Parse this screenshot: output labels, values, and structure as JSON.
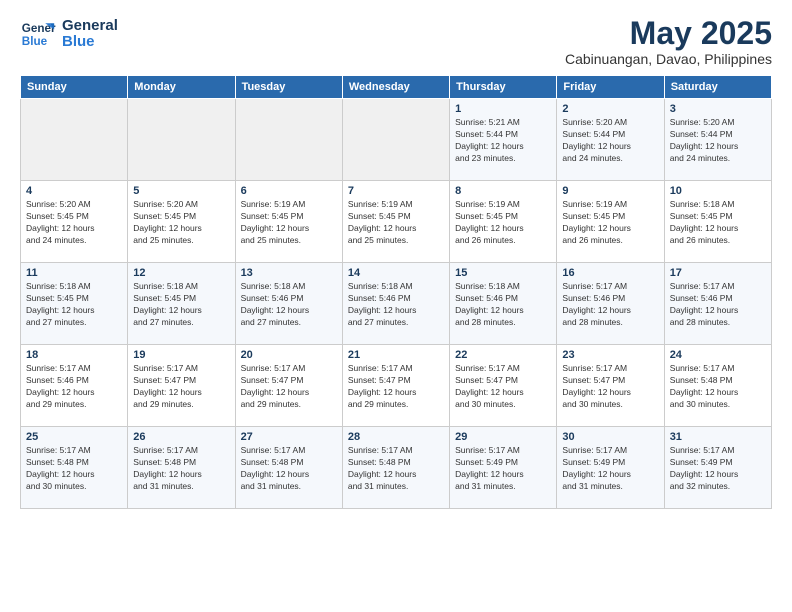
{
  "header": {
    "logo_line1": "General",
    "logo_line2": "Blue",
    "title": "May 2025",
    "subtitle": "Cabinuangan, Davao, Philippines"
  },
  "days_of_week": [
    "Sunday",
    "Monday",
    "Tuesday",
    "Wednesday",
    "Thursday",
    "Friday",
    "Saturday"
  ],
  "weeks": [
    [
      {
        "day": "",
        "info": ""
      },
      {
        "day": "",
        "info": ""
      },
      {
        "day": "",
        "info": ""
      },
      {
        "day": "",
        "info": ""
      },
      {
        "day": "1",
        "info": "Sunrise: 5:21 AM\nSunset: 5:44 PM\nDaylight: 12 hours\nand 23 minutes."
      },
      {
        "day": "2",
        "info": "Sunrise: 5:20 AM\nSunset: 5:44 PM\nDaylight: 12 hours\nand 24 minutes."
      },
      {
        "day": "3",
        "info": "Sunrise: 5:20 AM\nSunset: 5:44 PM\nDaylight: 12 hours\nand 24 minutes."
      }
    ],
    [
      {
        "day": "4",
        "info": "Sunrise: 5:20 AM\nSunset: 5:45 PM\nDaylight: 12 hours\nand 24 minutes."
      },
      {
        "day": "5",
        "info": "Sunrise: 5:20 AM\nSunset: 5:45 PM\nDaylight: 12 hours\nand 25 minutes."
      },
      {
        "day": "6",
        "info": "Sunrise: 5:19 AM\nSunset: 5:45 PM\nDaylight: 12 hours\nand 25 minutes."
      },
      {
        "day": "7",
        "info": "Sunrise: 5:19 AM\nSunset: 5:45 PM\nDaylight: 12 hours\nand 25 minutes."
      },
      {
        "day": "8",
        "info": "Sunrise: 5:19 AM\nSunset: 5:45 PM\nDaylight: 12 hours\nand 26 minutes."
      },
      {
        "day": "9",
        "info": "Sunrise: 5:19 AM\nSunset: 5:45 PM\nDaylight: 12 hours\nand 26 minutes."
      },
      {
        "day": "10",
        "info": "Sunrise: 5:18 AM\nSunset: 5:45 PM\nDaylight: 12 hours\nand 26 minutes."
      }
    ],
    [
      {
        "day": "11",
        "info": "Sunrise: 5:18 AM\nSunset: 5:45 PM\nDaylight: 12 hours\nand 27 minutes."
      },
      {
        "day": "12",
        "info": "Sunrise: 5:18 AM\nSunset: 5:45 PM\nDaylight: 12 hours\nand 27 minutes."
      },
      {
        "day": "13",
        "info": "Sunrise: 5:18 AM\nSunset: 5:46 PM\nDaylight: 12 hours\nand 27 minutes."
      },
      {
        "day": "14",
        "info": "Sunrise: 5:18 AM\nSunset: 5:46 PM\nDaylight: 12 hours\nand 27 minutes."
      },
      {
        "day": "15",
        "info": "Sunrise: 5:18 AM\nSunset: 5:46 PM\nDaylight: 12 hours\nand 28 minutes."
      },
      {
        "day": "16",
        "info": "Sunrise: 5:17 AM\nSunset: 5:46 PM\nDaylight: 12 hours\nand 28 minutes."
      },
      {
        "day": "17",
        "info": "Sunrise: 5:17 AM\nSunset: 5:46 PM\nDaylight: 12 hours\nand 28 minutes."
      }
    ],
    [
      {
        "day": "18",
        "info": "Sunrise: 5:17 AM\nSunset: 5:46 PM\nDaylight: 12 hours\nand 29 minutes."
      },
      {
        "day": "19",
        "info": "Sunrise: 5:17 AM\nSunset: 5:47 PM\nDaylight: 12 hours\nand 29 minutes."
      },
      {
        "day": "20",
        "info": "Sunrise: 5:17 AM\nSunset: 5:47 PM\nDaylight: 12 hours\nand 29 minutes."
      },
      {
        "day": "21",
        "info": "Sunrise: 5:17 AM\nSunset: 5:47 PM\nDaylight: 12 hours\nand 29 minutes."
      },
      {
        "day": "22",
        "info": "Sunrise: 5:17 AM\nSunset: 5:47 PM\nDaylight: 12 hours\nand 30 minutes."
      },
      {
        "day": "23",
        "info": "Sunrise: 5:17 AM\nSunset: 5:47 PM\nDaylight: 12 hours\nand 30 minutes."
      },
      {
        "day": "24",
        "info": "Sunrise: 5:17 AM\nSunset: 5:48 PM\nDaylight: 12 hours\nand 30 minutes."
      }
    ],
    [
      {
        "day": "25",
        "info": "Sunrise: 5:17 AM\nSunset: 5:48 PM\nDaylight: 12 hours\nand 30 minutes."
      },
      {
        "day": "26",
        "info": "Sunrise: 5:17 AM\nSunset: 5:48 PM\nDaylight: 12 hours\nand 31 minutes."
      },
      {
        "day": "27",
        "info": "Sunrise: 5:17 AM\nSunset: 5:48 PM\nDaylight: 12 hours\nand 31 minutes."
      },
      {
        "day": "28",
        "info": "Sunrise: 5:17 AM\nSunset: 5:48 PM\nDaylight: 12 hours\nand 31 minutes."
      },
      {
        "day": "29",
        "info": "Sunrise: 5:17 AM\nSunset: 5:49 PM\nDaylight: 12 hours\nand 31 minutes."
      },
      {
        "day": "30",
        "info": "Sunrise: 5:17 AM\nSunset: 5:49 PM\nDaylight: 12 hours\nand 31 minutes."
      },
      {
        "day": "31",
        "info": "Sunrise: 5:17 AM\nSunset: 5:49 PM\nDaylight: 12 hours\nand 32 minutes."
      }
    ]
  ]
}
